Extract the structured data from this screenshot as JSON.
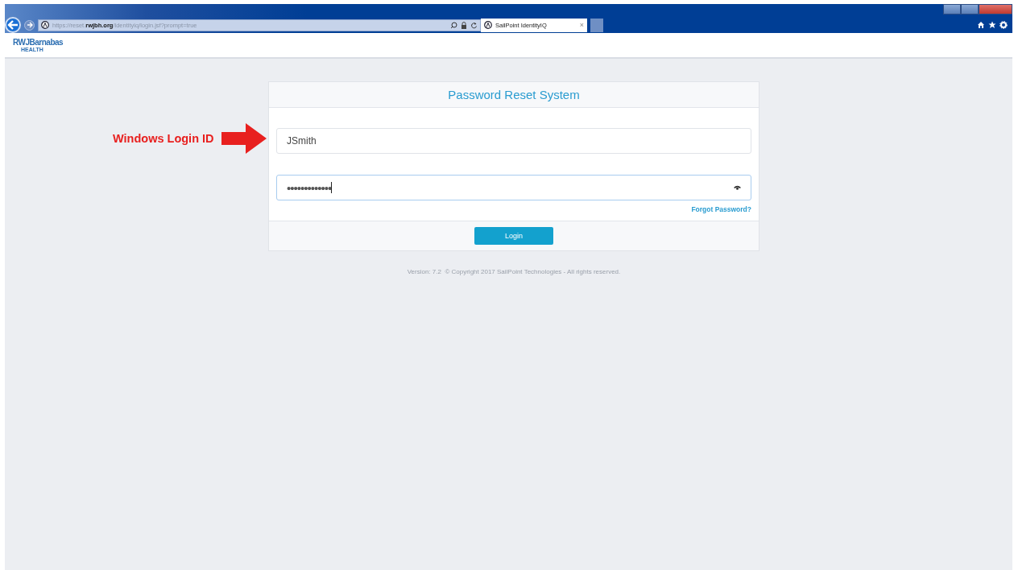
{
  "browser": {
    "address": "https://reset.**rwjbh.org**/identityiq/login.jsf?prompt=true",
    "tab": {
      "title": "SailPoint IdentityIQ",
      "close": "×",
      "selected": true
    }
  },
  "header": {
    "logo": "RWJBarnabas",
    "logo_sub": "HEALTH"
  },
  "annotation": {
    "label": "Windows Login ID"
  },
  "login": {
    "title": "Password Reset System",
    "fields": [
      {
        "kind": "text",
        "value": "JSmith",
        "focused": false
      },
      {
        "kind": "password",
        "value": "•••••••••••••",
        "focused": true
      }
    ],
    "forgot": "Forgot Password?",
    "button": "Login"
  },
  "footer": "Version: 7.2  © Copyright 2017 SailPoint Technologies - All rights reserved."
}
